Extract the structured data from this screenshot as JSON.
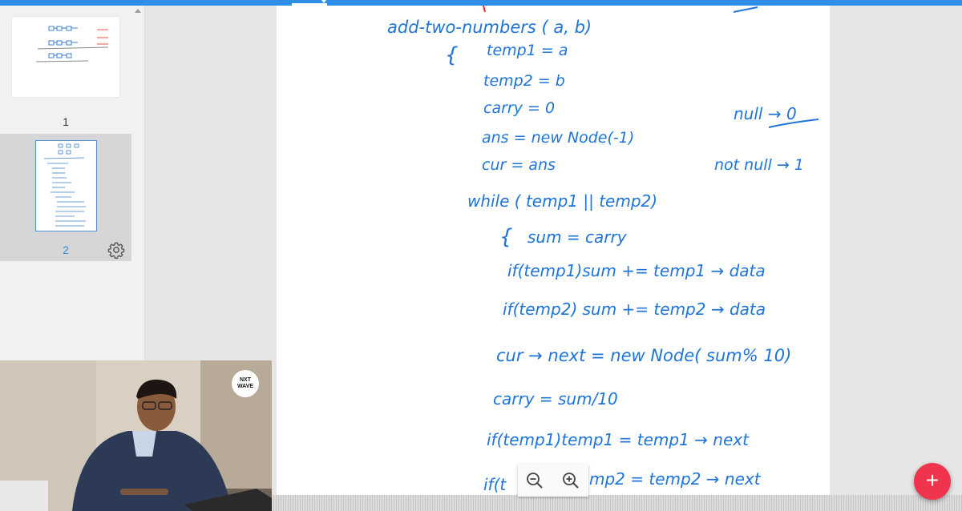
{
  "sidebar": {
    "pages": [
      {
        "number": "1"
      },
      {
        "number": "2",
        "selected": true
      }
    ],
    "settings_icon": "gear-icon"
  },
  "notes": {
    "lines": [
      "add-two-numbers ( a, b)",
      "{",
      "temp1 = a",
      "temp2 = b",
      "carry = 0",
      "ans = new Node(-1)",
      "cur = ans",
      "while ( temp1 || temp2)",
      "{",
      "sum = carry",
      "if(temp1)sum += temp1 → data",
      "if(temp2)  sum += temp2 → data",
      "cur → next = new Node( sum% 10)",
      "carry = sum/10",
      "if(temp1)temp1 = temp1 → next",
      "if(t",
      "mp2 = temp2 → next"
    ],
    "side_notes": [
      "null → 0",
      "not null → 1"
    ]
  },
  "webcam": {
    "logo_line1": "NXT",
    "logo_line2": "WAVE"
  },
  "zoom": {
    "zoom_out_icon": "zoom-out-icon",
    "zoom_in_icon": "zoom-in-icon"
  },
  "fab": {
    "label": "+"
  },
  "colors": {
    "accent": "#2d8fe6",
    "ink": "#1f74d8",
    "fab": "#f0344d"
  }
}
